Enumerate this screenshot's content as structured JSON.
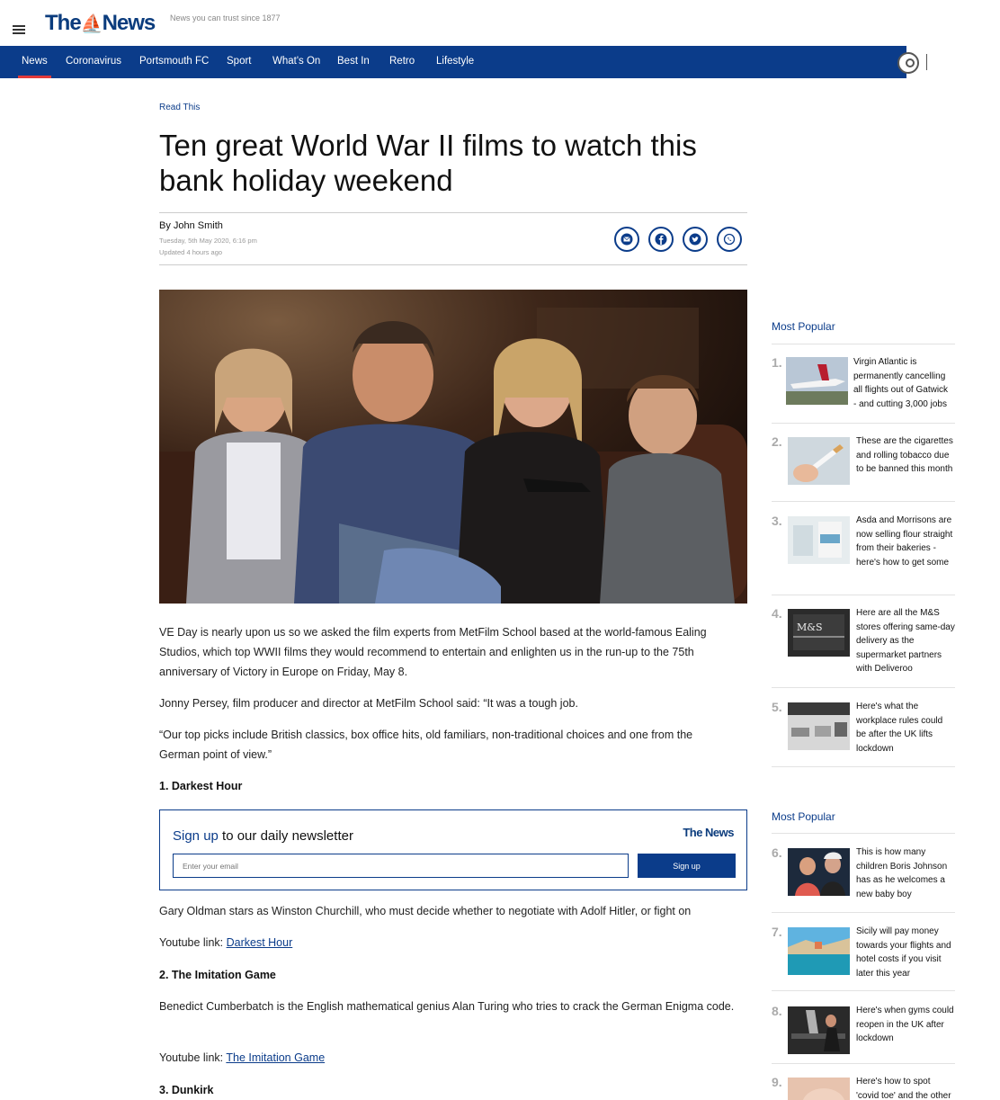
{
  "header": {
    "logo_text": "The News",
    "tagline": "News you can trust since 1877"
  },
  "nav": {
    "items": [
      "News",
      "Coronavirus",
      "Portsmouth FC",
      "Sport",
      "What's On",
      "Best In",
      "Retro",
      "Lifestyle"
    ],
    "active": "News"
  },
  "article": {
    "kicker": "Read This",
    "headline": "Ten great World War II films to watch this bank holiday weekend",
    "byline": "By John Smith",
    "published": "Tuesday, 5th May 2020, 6:16 pm",
    "updated": "Updated  4 hours ago",
    "share_icons": [
      "email-icon",
      "facebook-icon",
      "twitter-icon",
      "whatsapp-icon"
    ],
    "paragraphs": {
      "p1": "VE Day is nearly upon us so we asked the film experts from MetFilm School based at the world-famous Ealing Studios, which top WWII films they would recommend to entertain and enlighten us in the run-up to the 75th anniversary of Victory in Europe on Friday, May 8.",
      "p2": "Jonny Persey, film producer and director at MetFilm School said: “It was a tough job.",
      "p3": "“Our top picks include British classics, box office hits, old familiars, non-traditional choices and one from the German point of view.”",
      "h1": "1. Darkest Hour",
      "p4": "Gary Oldman stars as Winston Churchill, who must decide whether to negotiate with Adolf Hitler, or fight on",
      "yt_label": "Youtube link:",
      "link1": "Darkest Hour",
      "h2": "2. The Imitation Game",
      "p5": "Benedict Cumberbatch is the English mathematical genius Alan Turing who tries to crack the German Enigma code.",
      "link2": "The Imitation Game",
      "h3": "3. Dunkirk"
    }
  },
  "newsletter": {
    "title_highlight": "Sign up",
    "title_rest": " to our daily newsletter",
    "logo": "The News",
    "placeholder": "Enter your email",
    "button": "Sign up"
  },
  "sidebar": {
    "section1_title": "Most Popular",
    "section2_title": "Most Popular",
    "items": [
      {
        "num": "1.",
        "text": "Virgin Atlantic is permanently cancelling all flights out of Gatwick - and cutting 3,000 jobs"
      },
      {
        "num": "2.",
        "text": "These are the cigarettes and rolling tobacco due to be banned this month"
      },
      {
        "num": "3.",
        "text": "Asda and Morrisons are now selling flour straight from their bakeries - here's how to get some"
      },
      {
        "num": "4.",
        "text": "Here are all the M&S stores offering same-day delivery as the supermarket partners with Deliveroo"
      },
      {
        "num": "5.",
        "text": "Here's what the workplace rules could be after the UK lifts lockdown"
      },
      {
        "num": "6.",
        "text": "This is how many children Boris Johnson has as he welcomes a new baby boy"
      },
      {
        "num": "7.",
        "text": "Sicily will pay money towards your flights and hotel costs if you visit later this year"
      },
      {
        "num": "8.",
        "text": "Here's when gyms could reopen in the UK after lockdown"
      },
      {
        "num": "9.",
        "text": "Here's how to spot 'covid toe' and the other"
      }
    ]
  },
  "colors": {
    "brand_blue": "#0b3c8a",
    "accent_red": "#e23a3a"
  }
}
